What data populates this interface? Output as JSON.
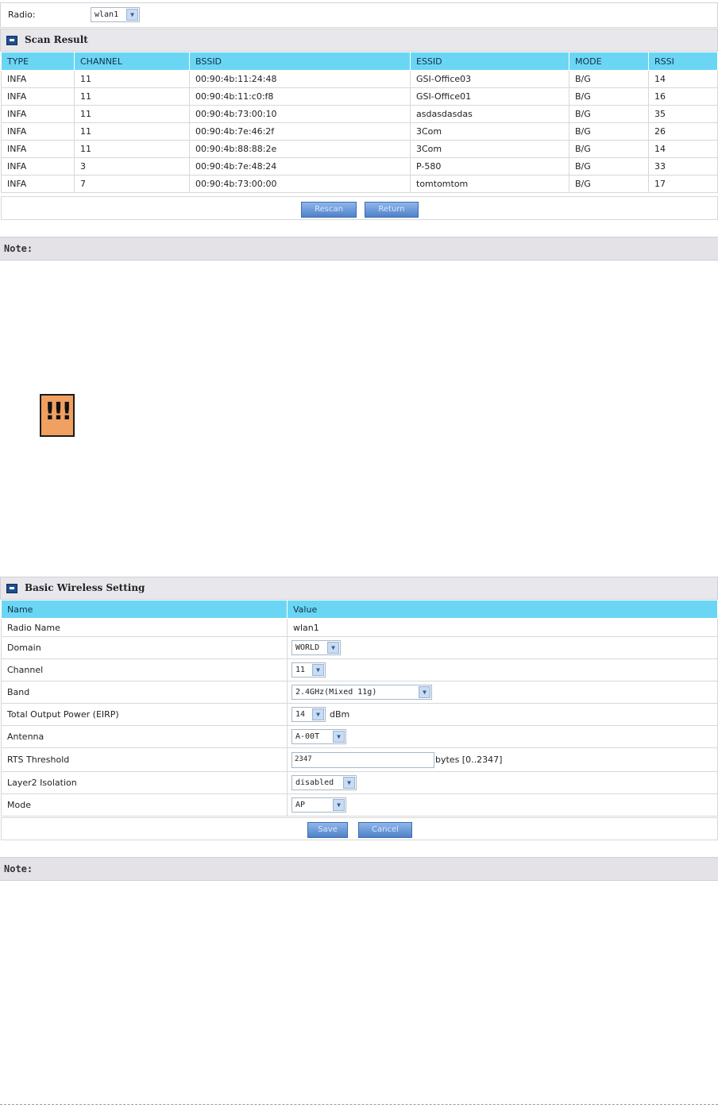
{
  "radio": {
    "label": "Radio:",
    "value": "wlan1"
  },
  "scan": {
    "title": "Scan Result",
    "headers": [
      "TYPE",
      "CHANNEL",
      "BSSID",
      "ESSID",
      "MODE",
      "RSSI"
    ],
    "rows": [
      [
        "INFA",
        "11",
        "00:90:4b:11:24:48",
        "GSI-Office03",
        "B/G",
        "14"
      ],
      [
        "INFA",
        "11",
        "00:90:4b:11:c0:f8",
        "GSI-Office01",
        "B/G",
        "16"
      ],
      [
        "INFA",
        "11",
        "00:90:4b:73:00:10",
        "asdasdasdas",
        "B/G",
        "35"
      ],
      [
        "INFA",
        "11",
        "00:90:4b:7e:46:2f",
        "3Com",
        "B/G",
        "26"
      ],
      [
        "INFA",
        "11",
        "00:90:4b:88:88:2e",
        "3Com",
        "B/G",
        "14"
      ],
      [
        "INFA",
        "3",
        "00:90:4b:7e:48:24",
        "P-580",
        "B/G",
        "33"
      ],
      [
        "INFA",
        "7",
        "00:90:4b:73:00:00",
        "tomtomtom",
        "B/G",
        "17"
      ]
    ],
    "rescan_label": "Rescan",
    "return_label": "Return"
  },
  "note1": {
    "label": "Note:"
  },
  "warning": {
    "symbol": "!!!",
    "icon": "warning-icon",
    "color": "#f0a060"
  },
  "basic": {
    "title": "Basic Wireless Setting",
    "col_name": "Name",
    "col_value": "Value",
    "radio_name_label": "Radio Name",
    "radio_name_value": "wlan1",
    "domain_label": "Domain",
    "domain_value": "WORLD",
    "channel_label": "Channel",
    "channel_value": "11",
    "band_label": "Band",
    "band_value": "2.4GHz(Mixed 11g)",
    "power_label": "Total Output Power (EIRP)",
    "power_value": "14",
    "power_unit": "dBm",
    "antenna_label": "Antenna",
    "antenna_value": "A-00T",
    "rts_label": "RTS Threshold",
    "rts_value": "2347",
    "rts_hint": "bytes [0..2347]",
    "isolation_label": "Layer2 Isolation",
    "isolation_value": "disabled",
    "mode_label": "Mode",
    "mode_value": "AP",
    "save_label": "Save",
    "cancel_label": "Cancel"
  },
  "note2": {
    "label": "Note:"
  },
  "colors": {
    "header_cyan": "#6bd6f4",
    "panel_gray": "#e8e8ec",
    "button_blue": "#4f82c8"
  }
}
